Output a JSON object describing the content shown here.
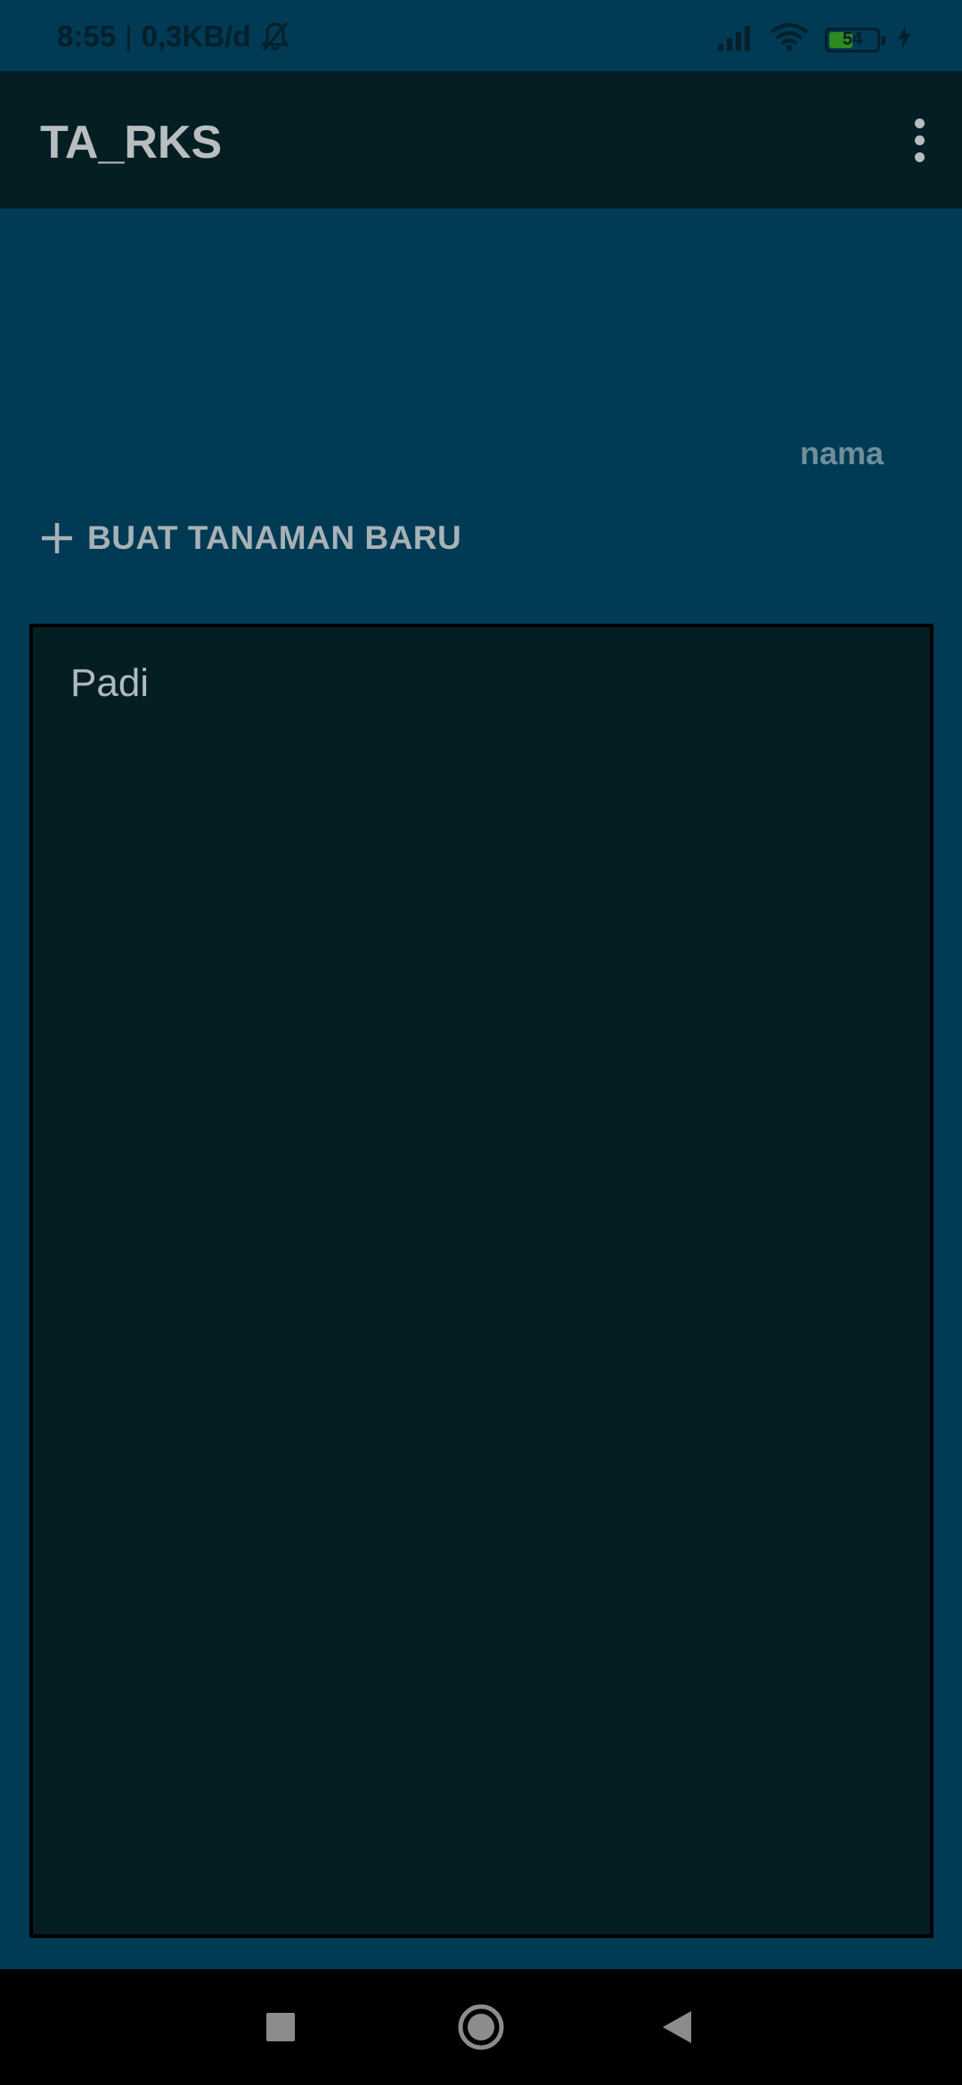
{
  "status_bar": {
    "time": "8:55",
    "separator": "|",
    "network_speed": "0,3KB/d",
    "battery_level": "54",
    "battery_fraction": 0.54,
    "icons": [
      "bell-muted-icon",
      "signal-icon",
      "wifi-icon",
      "battery-icon",
      "charging-icon"
    ]
  },
  "app_bar": {
    "title": "TA_RKS",
    "menu_icon": "more-vert-icon"
  },
  "main": {
    "name_label": "nama",
    "new_plant_button": {
      "icon": "plus-icon",
      "label": "BUAT TANAMAN BARU"
    },
    "plants": [
      {
        "name": "Padi"
      }
    ]
  },
  "nav_bar": {
    "icons": [
      "recents-square-icon",
      "home-circle-icon",
      "back-triangle-icon"
    ]
  },
  "colors": {
    "background": "#003a55",
    "app_bar": "#041e24",
    "list_background": "#041e24",
    "text_primary": "#b8bec0",
    "text_muted": "#6f8f9b",
    "battery_fill": "#2e8a1e"
  }
}
